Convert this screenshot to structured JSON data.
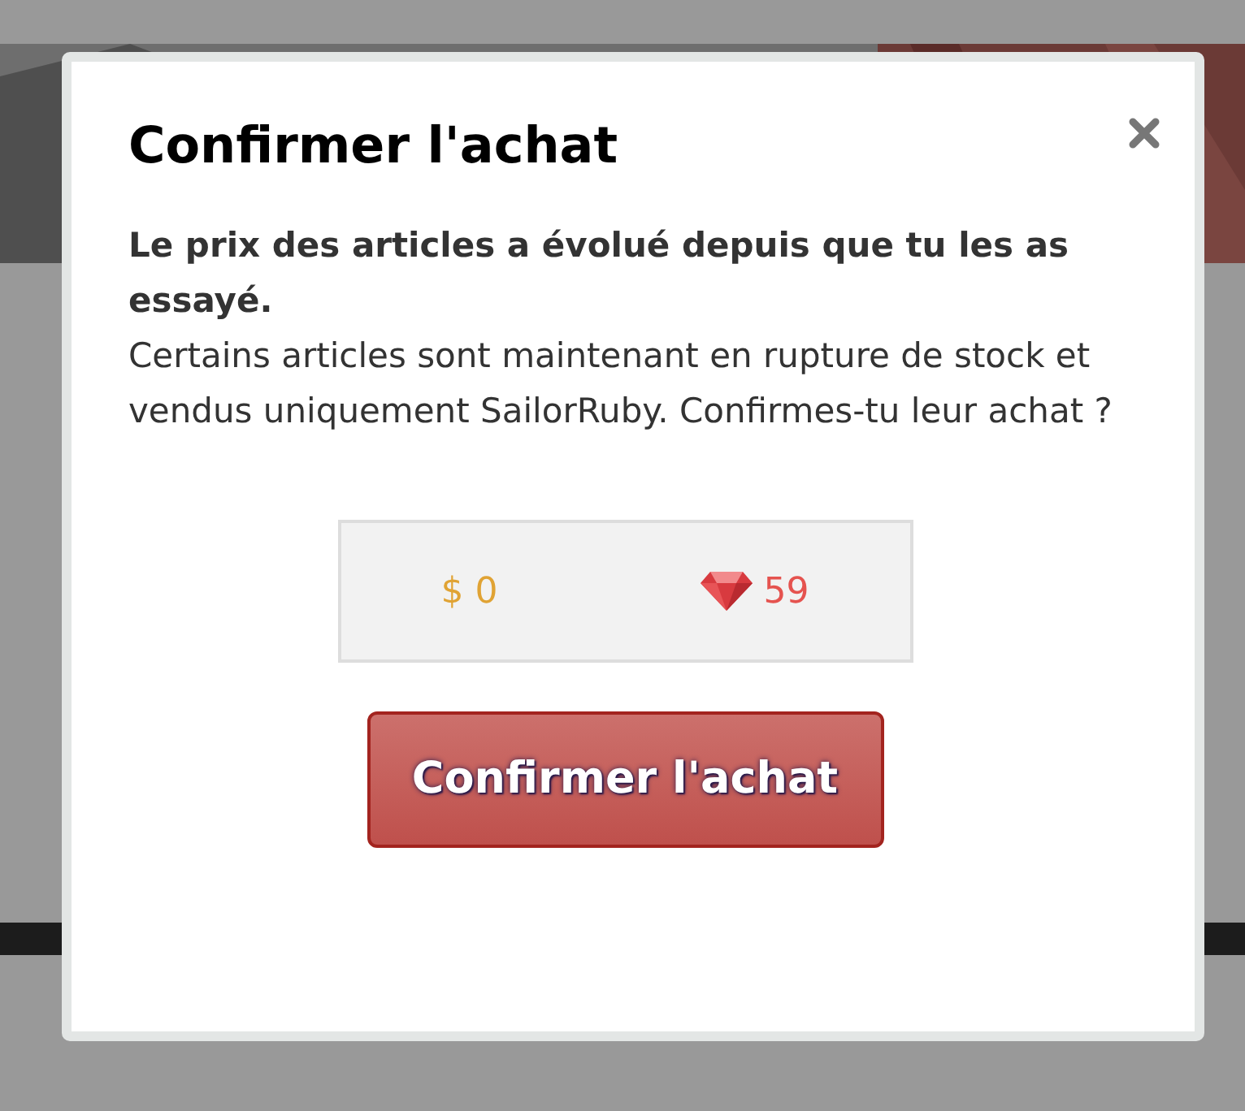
{
  "dialog": {
    "title": "Confirmer l'achat",
    "notice": "Le prix des articles a évolué depuis que tu les as essayé.",
    "message": "Certains articles sont maintenant en rupture de stock et vendus uniquement SailorRuby. Confirmes-tu leur achat ?",
    "balances": [
      {
        "kind": "dollar",
        "text": "$ 0"
      },
      {
        "kind": "ruby",
        "text": "59"
      }
    ],
    "confirm_button": "Confirmer l'achat"
  }
}
